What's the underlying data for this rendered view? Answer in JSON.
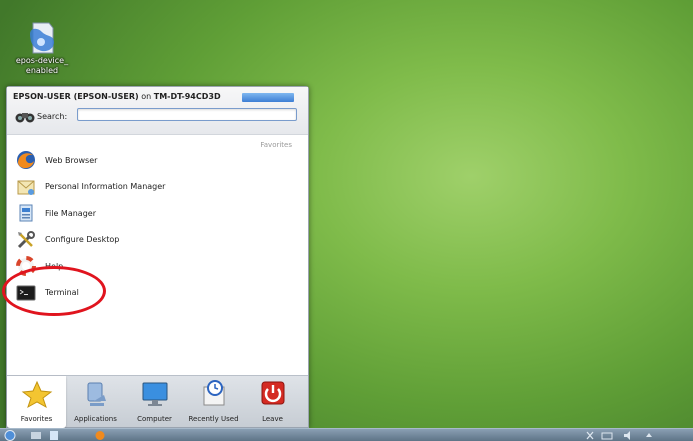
{
  "desktop": {
    "icon_label": "epos-device_ enabled"
  },
  "kickoff": {
    "user": "EPSON-USER (EPSON-USER)",
    "on_text": "on",
    "host": "TM-DT-94CD3D",
    "badge": "",
    "search_label": "Search:",
    "search_value": "",
    "section_label": "Favorites",
    "items": [
      {
        "label": "Web Browser",
        "icon": "firefox-icon"
      },
      {
        "label": "Personal Information Manager",
        "icon": "pim-icon"
      },
      {
        "label": "File Manager",
        "icon": "file-manager-icon"
      },
      {
        "label": "Configure Desktop",
        "icon": "tools-icon"
      },
      {
        "label": "Help",
        "icon": "lifebuoy-icon"
      },
      {
        "label": "Terminal",
        "icon": "terminal-icon"
      }
    ],
    "tabs": [
      {
        "label": "Favorites",
        "icon": "star-icon",
        "active": true
      },
      {
        "label": "Applications",
        "icon": "applications-icon"
      },
      {
        "label": "Computer",
        "icon": "computer-icon"
      },
      {
        "label": "Recently Used",
        "icon": "clock-icon"
      },
      {
        "label": "Leave",
        "icon": "power-icon"
      }
    ]
  },
  "taskbar": {
    "clock": ""
  },
  "colors": {
    "highlight_circle": "#e0141e",
    "badge": "#3d7ed4"
  }
}
